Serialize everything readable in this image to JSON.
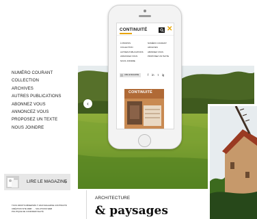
{
  "nav": {
    "items": [
      "NUMÉRO COURANT",
      "COLLECTION",
      "ARCHIVES",
      "AUTRES PUBLICATIONS",
      "ABONNEZ VOUS",
      "ANNONCEZ VOUS",
      "PROPOSEZ UN TEXTE",
      "NOUS JOINDRE"
    ]
  },
  "read_magazine": {
    "label": "LIRE LE MAGAZINE",
    "chevron": "›"
  },
  "legal": {
    "line1": "TOUS DROITS RÉSERVÉS © 2020 MAGAZINE CONTINUITÉ",
    "line2": "CRÉATION SITE WEB : ... SOLUTIONS WEB",
    "line3": "POLITIQUE DE CONFIDENTIALITÉ"
  },
  "carousel": {
    "prev_arrow": "‹"
  },
  "article": {
    "category": "ARCHITECTURE",
    "title": "& paysages"
  },
  "mobile": {
    "logo": "CONTINUITÉ",
    "close": "✕",
    "menu_col1": [
      "À PROPOS",
      "COLLECTION",
      "AUTRES PUBLICATIONS",
      "ANNONCEZ VOUS",
      "NOUS JOINDRE"
    ],
    "menu_col2": [
      "NUMÉRO COURANT",
      "ARCHIVES",
      "ABONNEZ VOUS",
      "PROPOSEZ UN TEXTE"
    ],
    "read_label": "LIRE LE MAGAZINE",
    "socials": [
      "f",
      "in",
      "t",
      "ig"
    ],
    "cover_title": "CONTINUITÉ"
  },
  "colors": {
    "accent": "#e8a400",
    "sky": "#dfe6e8",
    "grass": "#6f9a2c",
    "trees": "#3f5a1e",
    "mill_roof": "#9a3a22",
    "mill_stone": "#c6996b"
  }
}
